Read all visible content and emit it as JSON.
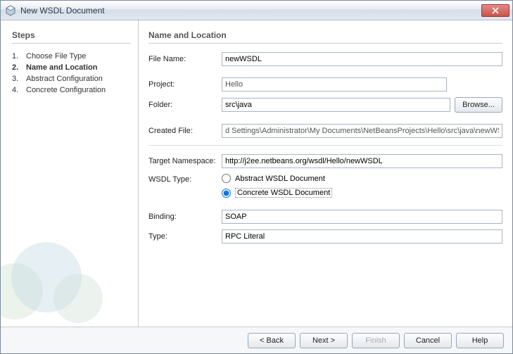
{
  "window": {
    "title": "New WSDL Document"
  },
  "sidebar": {
    "heading": "Steps",
    "steps": [
      {
        "num": "1.",
        "label": "Choose File Type"
      },
      {
        "num": "2.",
        "label": "Name and Location"
      },
      {
        "num": "3.",
        "label": "Abstract Configuration"
      },
      {
        "num": "4.",
        "label": "Concrete Configuration"
      }
    ]
  },
  "main": {
    "heading": "Name and Location",
    "labels": {
      "file_name": "File Name:",
      "project": "Project:",
      "folder": "Folder:",
      "created_file": "Created File:",
      "target_ns": "Target Namespace:",
      "wsdl_type": "WSDL Type:",
      "binding": "Binding:",
      "type": "Type:"
    },
    "values": {
      "file_name": "newWSDL",
      "project": "Hello",
      "folder": "src\\java",
      "created_file": "d Settings\\Administrator\\My Documents\\NetBeansProjects\\Hello\\src\\java\\newWSDL.wsdl",
      "target_ns": "http://j2ee.netbeans.org/wsdl/Hello/newWSDL",
      "binding": "SOAP",
      "type": "RPC Literal"
    },
    "radios": {
      "abstract": "Abstract WSDL Document",
      "concrete": "Concrete WSDL Document"
    },
    "buttons": {
      "browse": "Browse..."
    }
  },
  "footer": {
    "back": "< Back",
    "next": "Next >",
    "finish": "Finish",
    "cancel": "Cancel",
    "help": "Help"
  }
}
